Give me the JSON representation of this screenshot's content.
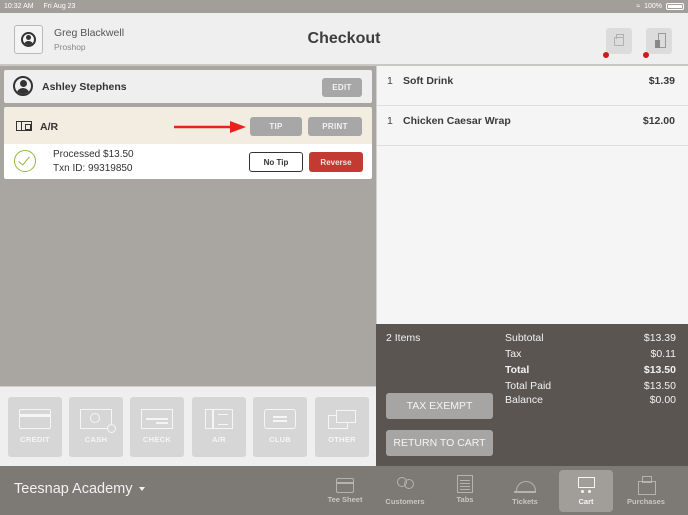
{
  "status_bar": {
    "time": "10:32 AM",
    "date": "Fri Aug 23",
    "battery": "100%"
  },
  "header": {
    "user_name": "Greg Blackwell",
    "user_role": "Proshop",
    "title": "Checkout",
    "icons": [
      "printer-icon",
      "cash-drawer-icon"
    ],
    "alert_color": "#d01a1a"
  },
  "customer": {
    "name": "Ashley Stephens",
    "edit_label": "EDIT"
  },
  "payment": {
    "method": "A/R",
    "tip_label": "TIP",
    "print_label": "PRINT",
    "processed": "Processed $13.50",
    "txn": "Txn ID: 99319850",
    "no_tip_label": "No Tip",
    "reverse_label": "Reverse",
    "reverse_color": "#c33a33",
    "success_color": "#8dbb3c"
  },
  "tenders": [
    {
      "label": "CREDIT",
      "icon": "credit-card-icon"
    },
    {
      "label": "CASH",
      "icon": "cash-icon"
    },
    {
      "label": "CHECK",
      "icon": "check-icon"
    },
    {
      "label": "A/R",
      "icon": "ar-icon"
    },
    {
      "label": "CLUB",
      "icon": "club-icon"
    },
    {
      "label": "OTHER",
      "icon": "other-icon"
    }
  ],
  "cart": {
    "items": [
      {
        "qty": "1",
        "name": "Soft Drink",
        "price": "$1.39"
      },
      {
        "qty": "1",
        "name": "Chicken Caesar Wrap",
        "price": "$12.00"
      }
    ]
  },
  "summary": {
    "item_count": "2 Items",
    "rows": [
      {
        "label": "Subtotal",
        "value": "$13.39",
        "bold": false
      },
      {
        "label": "Tax",
        "value": "$0.11",
        "bold": false
      },
      {
        "label": "Total",
        "value": "$13.50",
        "bold": true
      },
      {
        "label": "Total Paid",
        "value": "$13.50",
        "bold": false
      },
      {
        "label": "Balance",
        "value": "$0.00",
        "bold": false
      }
    ],
    "tax_exempt_label": "TAX EXEMPT",
    "return_label": "RETURN TO CART"
  },
  "bottom_nav": {
    "org": "Teesnap Academy",
    "items": [
      {
        "label": "Tee Sheet",
        "icon": "calendar-icon",
        "active": false
      },
      {
        "label": "Customers",
        "icon": "customers-icon",
        "active": false
      },
      {
        "label": "Tabs",
        "icon": "tabs-icon",
        "active": false
      },
      {
        "label": "Tickets",
        "icon": "tickets-icon",
        "active": false
      },
      {
        "label": "Cart",
        "icon": "cart-icon",
        "active": true
      },
      {
        "label": "Purchases",
        "icon": "register-icon",
        "active": false
      }
    ]
  }
}
